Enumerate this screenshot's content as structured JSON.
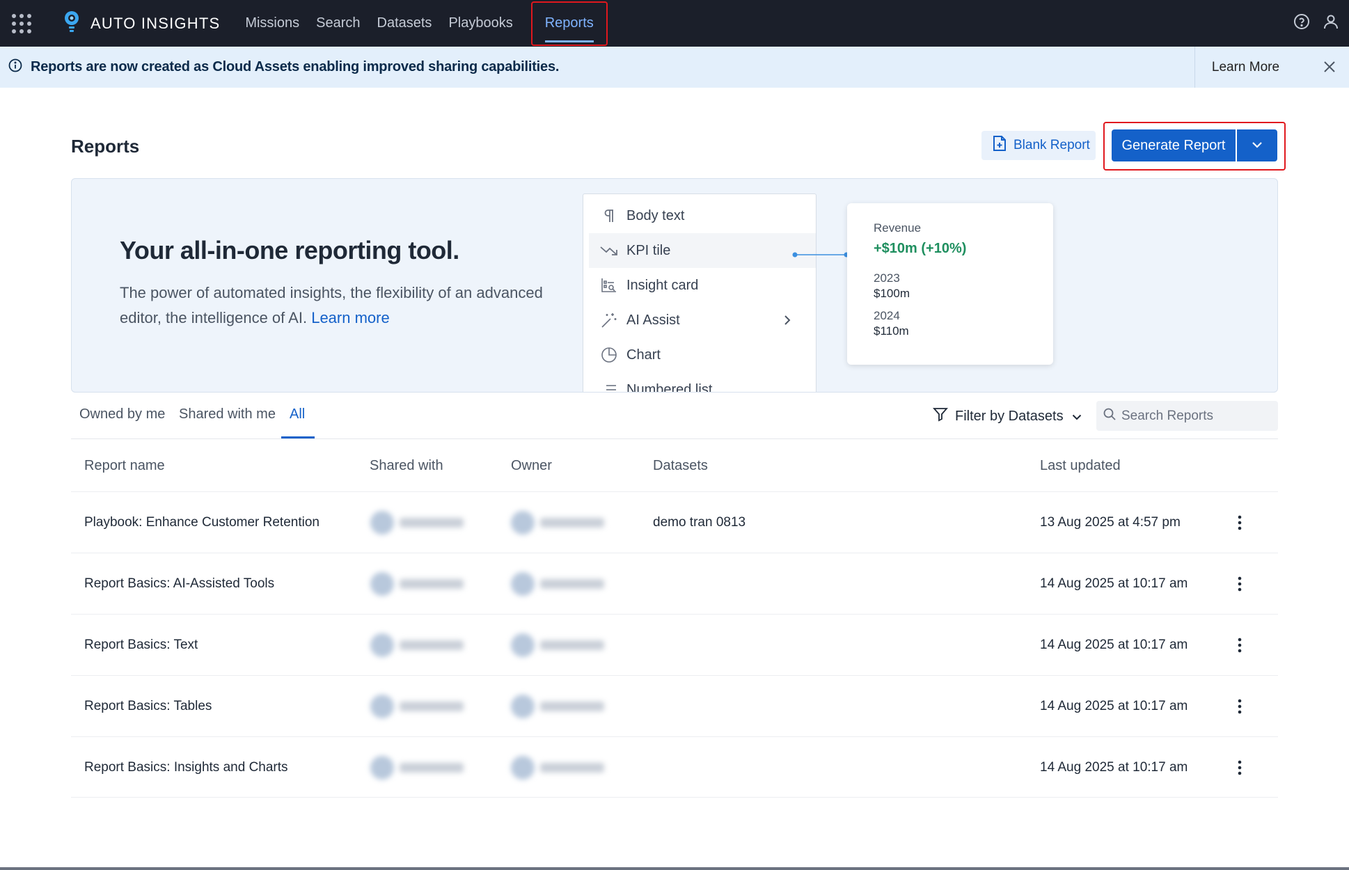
{
  "brand": {
    "name": "AUTO INSIGHTS"
  },
  "nav": {
    "items": [
      "Missions",
      "Search",
      "Datasets",
      "Playbooks",
      "Reports"
    ],
    "active": "Reports"
  },
  "banner": {
    "message": "Reports are now created as Cloud Assets enabling improved sharing capabilities.",
    "learn_more": "Learn More"
  },
  "header": {
    "title": "Reports",
    "blank_report": "Blank Report",
    "generate_report": "Generate Report"
  },
  "promo": {
    "title": "Your all-in-one reporting tool.",
    "description": "The power of automated insights, the flexibility of an advanced editor, the intelligence of AI.",
    "link": "Learn more",
    "menu": [
      "Body text",
      "KPI tile",
      "Insight card",
      "AI Assist",
      "Chart",
      "Numbered list"
    ],
    "kpi": {
      "label": "Revenue",
      "change": "+$10m (+10%)",
      "year1": "2023",
      "value1": "$100m",
      "year2": "2024",
      "value2": "$110m"
    }
  },
  "tabs": {
    "items": [
      "Owned by me",
      "Shared with me",
      "All"
    ],
    "active": "All"
  },
  "filter": {
    "label": "Filter by Datasets"
  },
  "search": {
    "placeholder": "Search Reports"
  },
  "table": {
    "columns": [
      "Report name",
      "Shared with",
      "Owner",
      "Datasets",
      "Last updated"
    ],
    "rows": [
      {
        "name": "Playbook: Enhance Customer Retention",
        "datasets": "demo tran 0813",
        "updated": "13 Aug 2025 at 4:57 pm"
      },
      {
        "name": "Report Basics: AI-Assisted Tools",
        "datasets": "",
        "updated": "14 Aug 2025 at 10:17 am"
      },
      {
        "name": "Report Basics: Text",
        "datasets": "",
        "updated": "14 Aug 2025 at 10:17 am"
      },
      {
        "name": "Report Basics: Tables",
        "datasets": "",
        "updated": "14 Aug 2025 at 10:17 am"
      },
      {
        "name": "Report Basics: Insights and Charts",
        "datasets": "",
        "updated": "14 Aug 2025 at 10:17 am"
      }
    ]
  },
  "colors": {
    "nav_bg": "#1b1f2a",
    "accent": "#1461c9",
    "banner_bg": "#e3effb",
    "highlight": "#e0181e",
    "kpi_green": "#1f8f5f"
  }
}
